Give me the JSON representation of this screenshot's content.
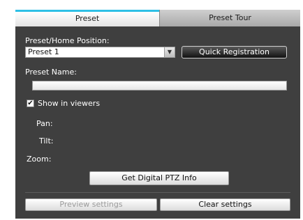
{
  "tabs": [
    {
      "label": "Preset",
      "active": true
    },
    {
      "label": "Preset Tour",
      "active": false
    }
  ],
  "preset_home": {
    "label": "Preset/Home Position:",
    "selected": "Preset 1"
  },
  "quick_registration_label": "Quick Registration",
  "preset_name": {
    "label": "Preset Name:",
    "value": ""
  },
  "show_in_viewers": {
    "label": "Show in viewers",
    "checked": true
  },
  "ptz": {
    "pan_label": "Pan:",
    "tilt_label": "Tilt:",
    "zoom_label": "Zoom:"
  },
  "get_ptz_label": "Get Digital PTZ Info",
  "footer": {
    "preview_label": "Preview settings",
    "clear_label": "Clear settings"
  },
  "colors": {
    "panel_bg": "#3f3f3f",
    "active_tab_accent": "#2ec0e6"
  }
}
